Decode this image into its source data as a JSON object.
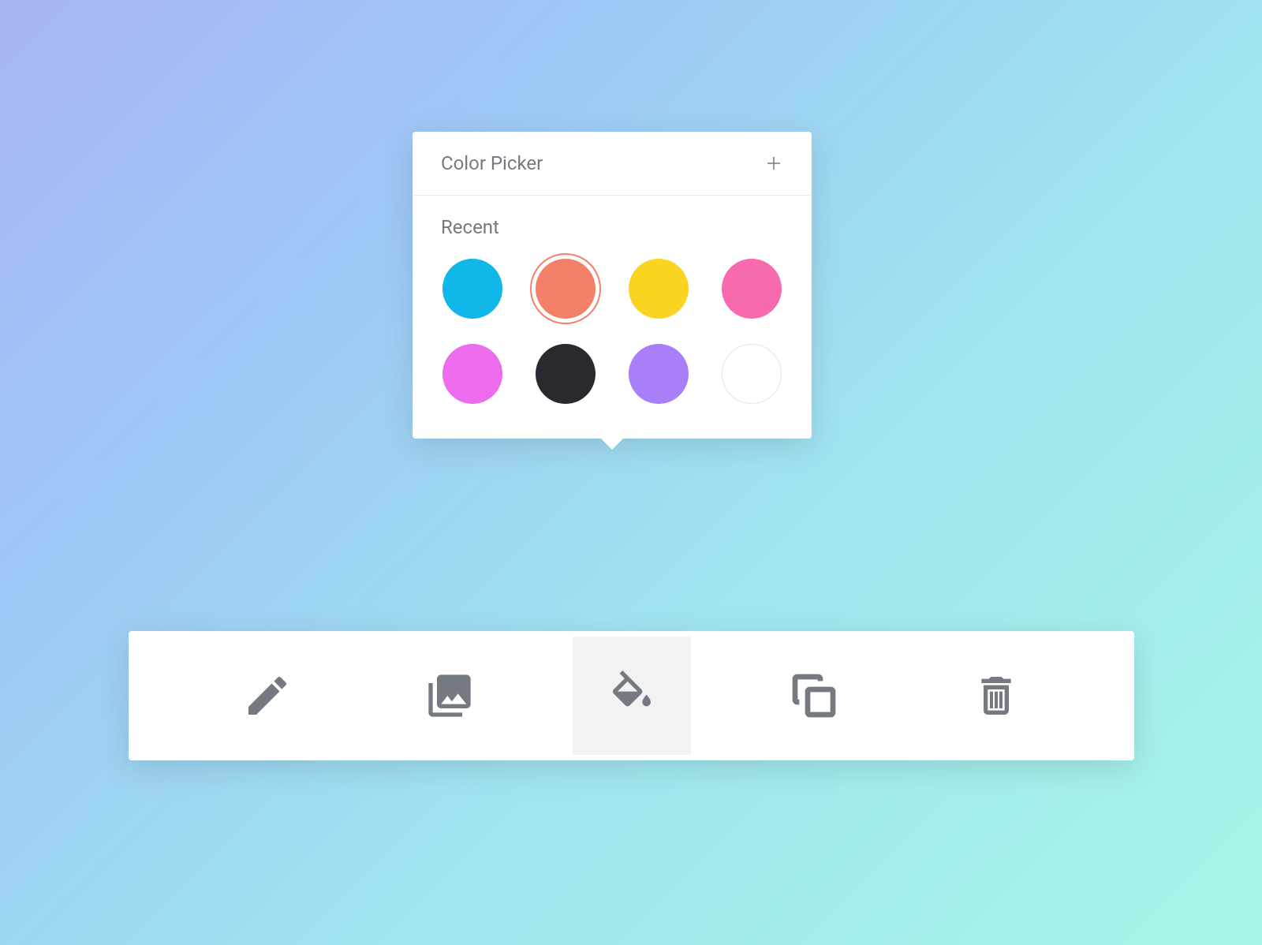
{
  "popover": {
    "title": "Color Picker",
    "section_label": "Recent",
    "swatches": [
      {
        "color": "#10b7e8",
        "selected": false,
        "has_border": false
      },
      {
        "color": "#f38169",
        "selected": true,
        "has_border": false
      },
      {
        "color": "#f9d420",
        "selected": false,
        "has_border": false
      },
      {
        "color": "#f76aae",
        "selected": false,
        "has_border": false
      },
      {
        "color": "#ed6cee",
        "selected": false,
        "has_border": false
      },
      {
        "color": "#282a30",
        "selected": false,
        "has_border": false
      },
      {
        "color": "#a87ef9",
        "selected": false,
        "has_border": false
      },
      {
        "color": "#ffffff",
        "selected": false,
        "has_border": true
      }
    ]
  },
  "toolbar": {
    "items": [
      {
        "name": "edit",
        "icon": "pencil-icon",
        "active": false
      },
      {
        "name": "images",
        "icon": "images-icon",
        "active": false
      },
      {
        "name": "fill",
        "icon": "paint-bucket-icon",
        "active": true
      },
      {
        "name": "copy",
        "icon": "copy-icon",
        "active": false
      },
      {
        "name": "delete",
        "icon": "trash-icon",
        "active": false
      }
    ]
  }
}
